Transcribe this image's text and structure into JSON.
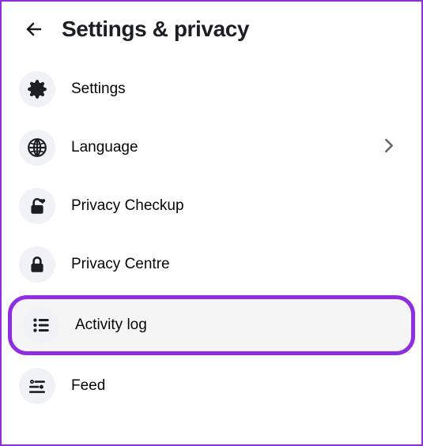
{
  "header": {
    "title": "Settings & privacy"
  },
  "items": [
    {
      "icon": "gear",
      "label": "Settings",
      "chevron": false,
      "highlight": false
    },
    {
      "icon": "globe",
      "label": "Language",
      "chevron": true,
      "highlight": false
    },
    {
      "icon": "lock-open-heart",
      "label": "Privacy Checkup",
      "chevron": false,
      "highlight": false
    },
    {
      "icon": "lock",
      "label": "Privacy Centre",
      "chevron": false,
      "highlight": false
    },
    {
      "icon": "list",
      "label": "Activity log",
      "chevron": false,
      "highlight": true
    },
    {
      "icon": "sliders",
      "label": "Feed",
      "chevron": false,
      "highlight": false
    }
  ]
}
